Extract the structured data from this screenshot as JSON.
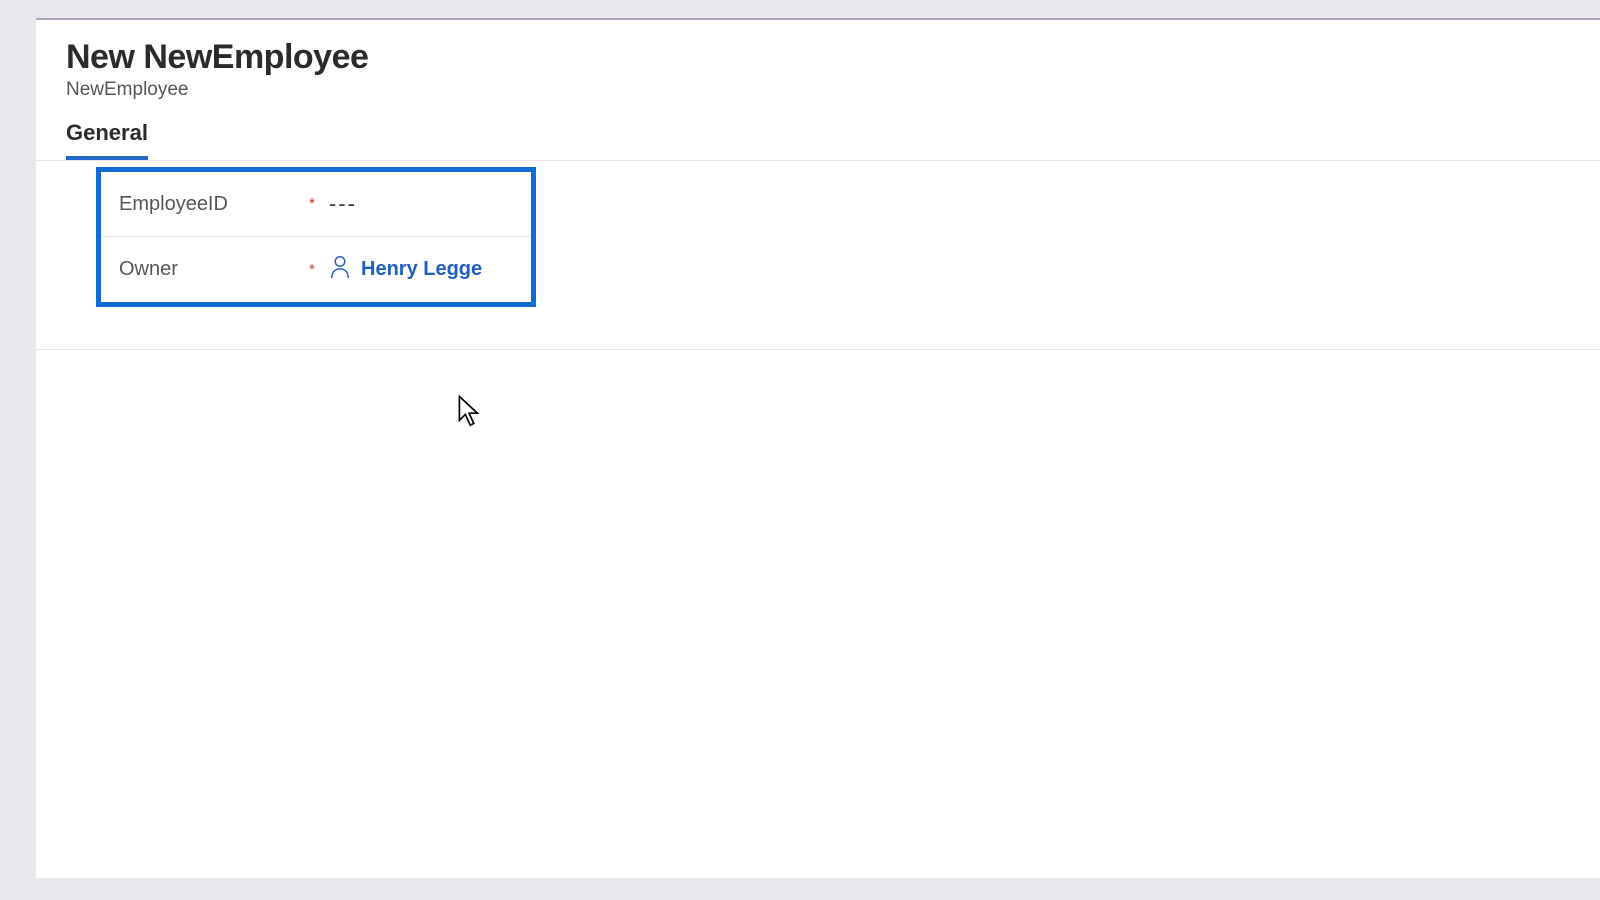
{
  "header": {
    "title": "New NewEmployee",
    "subtitle": "NewEmployee"
  },
  "tabs": {
    "active_label": "General"
  },
  "form": {
    "required_mark": "*",
    "fields": {
      "employee_id": {
        "label": "EmployeeID",
        "placeholder": "---"
      },
      "owner": {
        "label": "Owner",
        "value": "Henry Legge"
      }
    }
  }
}
